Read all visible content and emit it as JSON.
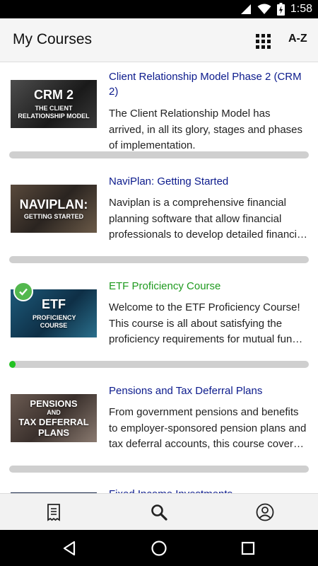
{
  "status_bar": {
    "time": "1:58",
    "battery_glyph": "⚡"
  },
  "app_bar": {
    "title": "My Courses",
    "sort_label": "A-Z"
  },
  "courses": [
    {
      "title": "Client Relationship Model Phase 2 (CRM 2)",
      "description": "The Client Relationship Model has arrived, in all its glory, stages and phases of implementation.",
      "thumb_big": "CRM 2",
      "thumb_small": "THE CLIENT RELATIONSHIP MODEL",
      "title_color": "#0b1a8c",
      "progress": 0,
      "completed": false
    },
    {
      "title": "NaviPlan: Getting Started",
      "description": "Naviplan is a comprehensive financial planning software that allow financial professionals to develop detailed financial plans.",
      "thumb_big": "NAVIPLAN:",
      "thumb_small": "GETTING STARTED",
      "title_color": "#0b1a8c",
      "progress": 0,
      "completed": false
    },
    {
      "title": "ETF Proficiency Course",
      "description": "Welcome to the ETF Proficiency Course! This course is all about satisfying the proficiency requirements for mutual fund dealers.",
      "thumb_big": "ETF",
      "thumb_small": "PROFICIENCY COURSE",
      "title_color": "#1f9a1f",
      "progress": 0.02,
      "completed": true
    },
    {
      "title": "Pensions and Tax Deferral Plans",
      "description": "From government pensions and benefits to employer-sponsored pension plans and tax deferral accounts, this course covers it all.",
      "thumb_big": "PENSIONS",
      "thumb_small": "AND",
      "thumb_big2": "TAX DEFERRAL PLANS",
      "title_color": "#0b1a8c",
      "progress": 0,
      "completed": false
    },
    {
      "title": "Fixed Income Investments",
      "description": "",
      "title_color": "#0b1a8c",
      "progress": 0,
      "completed": false
    }
  ],
  "colors": {
    "progress_fill": "#22c222",
    "progress_track": "#cfcfcf"
  },
  "bottom_nav": [
    "receipt-icon",
    "search-icon",
    "profile-icon"
  ],
  "system_nav": [
    "back-icon",
    "home-icon",
    "recents-icon"
  ]
}
